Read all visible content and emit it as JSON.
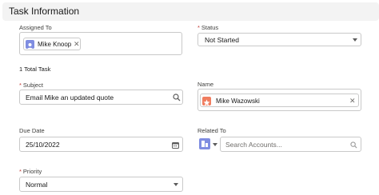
{
  "section": {
    "title": "Task Information"
  },
  "assigned_to": {
    "label": "Assigned To",
    "pill_name": "Mike Knoop",
    "close_symbol": "✕",
    "avatar_color": "#7f8de1"
  },
  "status": {
    "required_mark": "*",
    "label": "Status",
    "value": "Not Started"
  },
  "total_tasks": "1 Total Task",
  "subject": {
    "required_mark": "*",
    "label": "Subject",
    "value": "Email Mike an updated quote"
  },
  "name": {
    "label": "Name",
    "pill_name": "Mike Wazowski",
    "close_symbol": "✕",
    "avatar_color": "#f07d5f"
  },
  "due_date": {
    "label": "Due Date",
    "value": "25/10/2022"
  },
  "related_to": {
    "label": "Related To",
    "placeholder": "Search Accounts...",
    "object_icon_color": "#7f8de1"
  },
  "priority": {
    "required_mark": "*",
    "label": "Priority",
    "value": "Normal"
  }
}
